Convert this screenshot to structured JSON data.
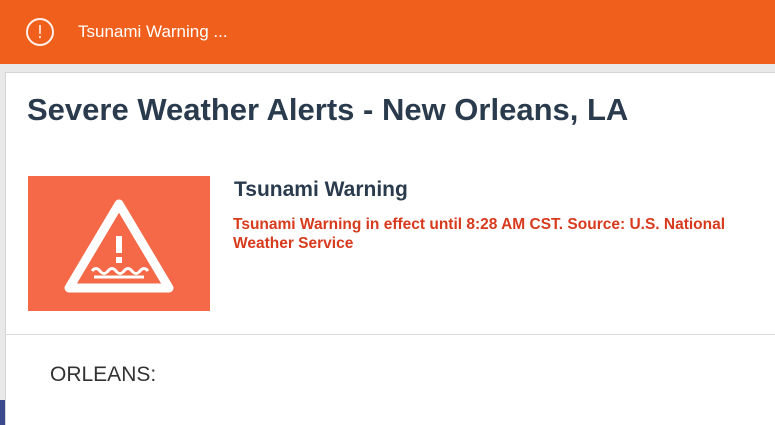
{
  "banner": {
    "icon": "exclamation-circle-icon",
    "text": "Tsunami Warning ..."
  },
  "page": {
    "title": "Severe Weather Alerts - New Orleans, LA"
  },
  "alert": {
    "image_icon": "tsunami-warning-triangle-icon",
    "image_bg_color": "#f56848",
    "title": "Tsunami Warning",
    "description": "Tsunami Warning in effect until 8:28 AM CST. Source: U.S. National Weather Service"
  },
  "area": {
    "label": "ORLEANS:"
  },
  "colors": {
    "banner": "#f05f1c",
    "title": "#2a3b4d",
    "description": "#d83a1d"
  }
}
